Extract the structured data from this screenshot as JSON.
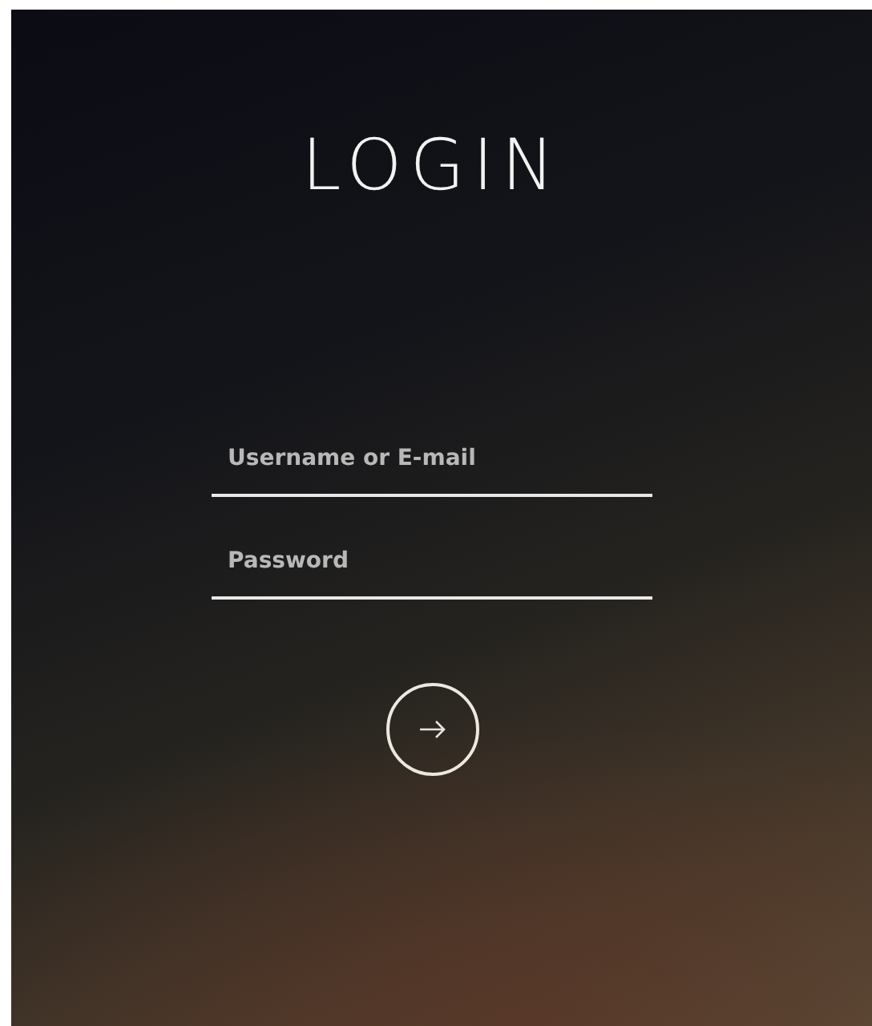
{
  "title": "LOGIN",
  "fields": [
    {
      "placeholder": "Username or E-mail"
    },
    {
      "placeholder": "Password"
    }
  ]
}
